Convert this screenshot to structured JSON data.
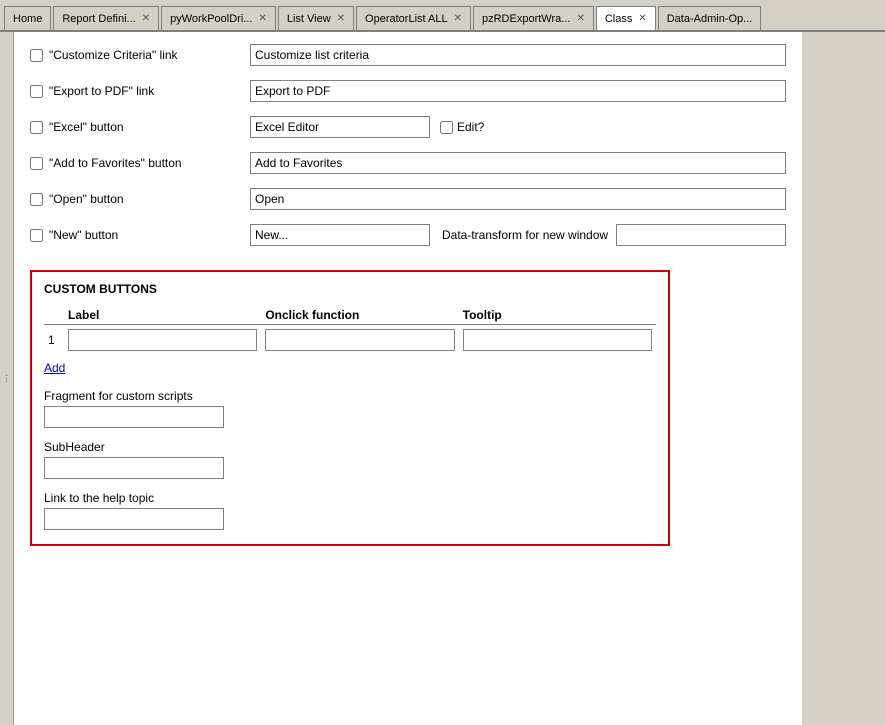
{
  "tabs": [
    {
      "label": "Home",
      "closable": false,
      "active": false
    },
    {
      "label": "Report Defini...",
      "closable": true,
      "active": false
    },
    {
      "label": "pyWorkPoolDri...",
      "closable": true,
      "active": false
    },
    {
      "label": "List View",
      "closable": true,
      "active": false
    },
    {
      "label": "OperatorList ALL",
      "closable": true,
      "active": false
    },
    {
      "label": "pzRDExportWra...",
      "closable": true,
      "active": false
    },
    {
      "label": "Class",
      "closable": true,
      "active": true
    },
    {
      "label": "Data-Admin-Op...",
      "closable": false,
      "active": false
    }
  ],
  "form": {
    "customize_criteria": {
      "checkbox_label": "\"Customize Criteria\" link",
      "input_value": "Customize list criteria"
    },
    "export_pdf": {
      "checkbox_label": "\"Export to PDF\" link",
      "input_value": "Export to PDF"
    },
    "excel_button": {
      "checkbox_label": "\"Excel\" button",
      "input_value": "Excel Editor",
      "edit_label": "Edit?"
    },
    "add_favorites": {
      "checkbox_label": "\"Add to Favorites\" button",
      "input_value": "Add to Favorites"
    },
    "open_button": {
      "checkbox_label": "\"Open\" button",
      "input_value": "Open"
    },
    "new_button": {
      "checkbox_label": "\"New\" button",
      "input_value": "New...",
      "data_transform_label": "Data-transform for new window",
      "data_transform_value": ""
    }
  },
  "custom_buttons": {
    "section_title": "CUSTOM BUTTONS",
    "columns": [
      "Label",
      "Onclick function",
      "Tooltip"
    ],
    "rows": [
      {
        "row_num": "1",
        "label": "",
        "onclick": "",
        "tooltip": ""
      }
    ],
    "add_link": "Add",
    "fragment_label": "Fragment for custom scripts",
    "fragment_value": "",
    "subheader_label": "SubHeader",
    "subheader_value": "",
    "help_label": "Link to the help topic",
    "help_value": ""
  }
}
